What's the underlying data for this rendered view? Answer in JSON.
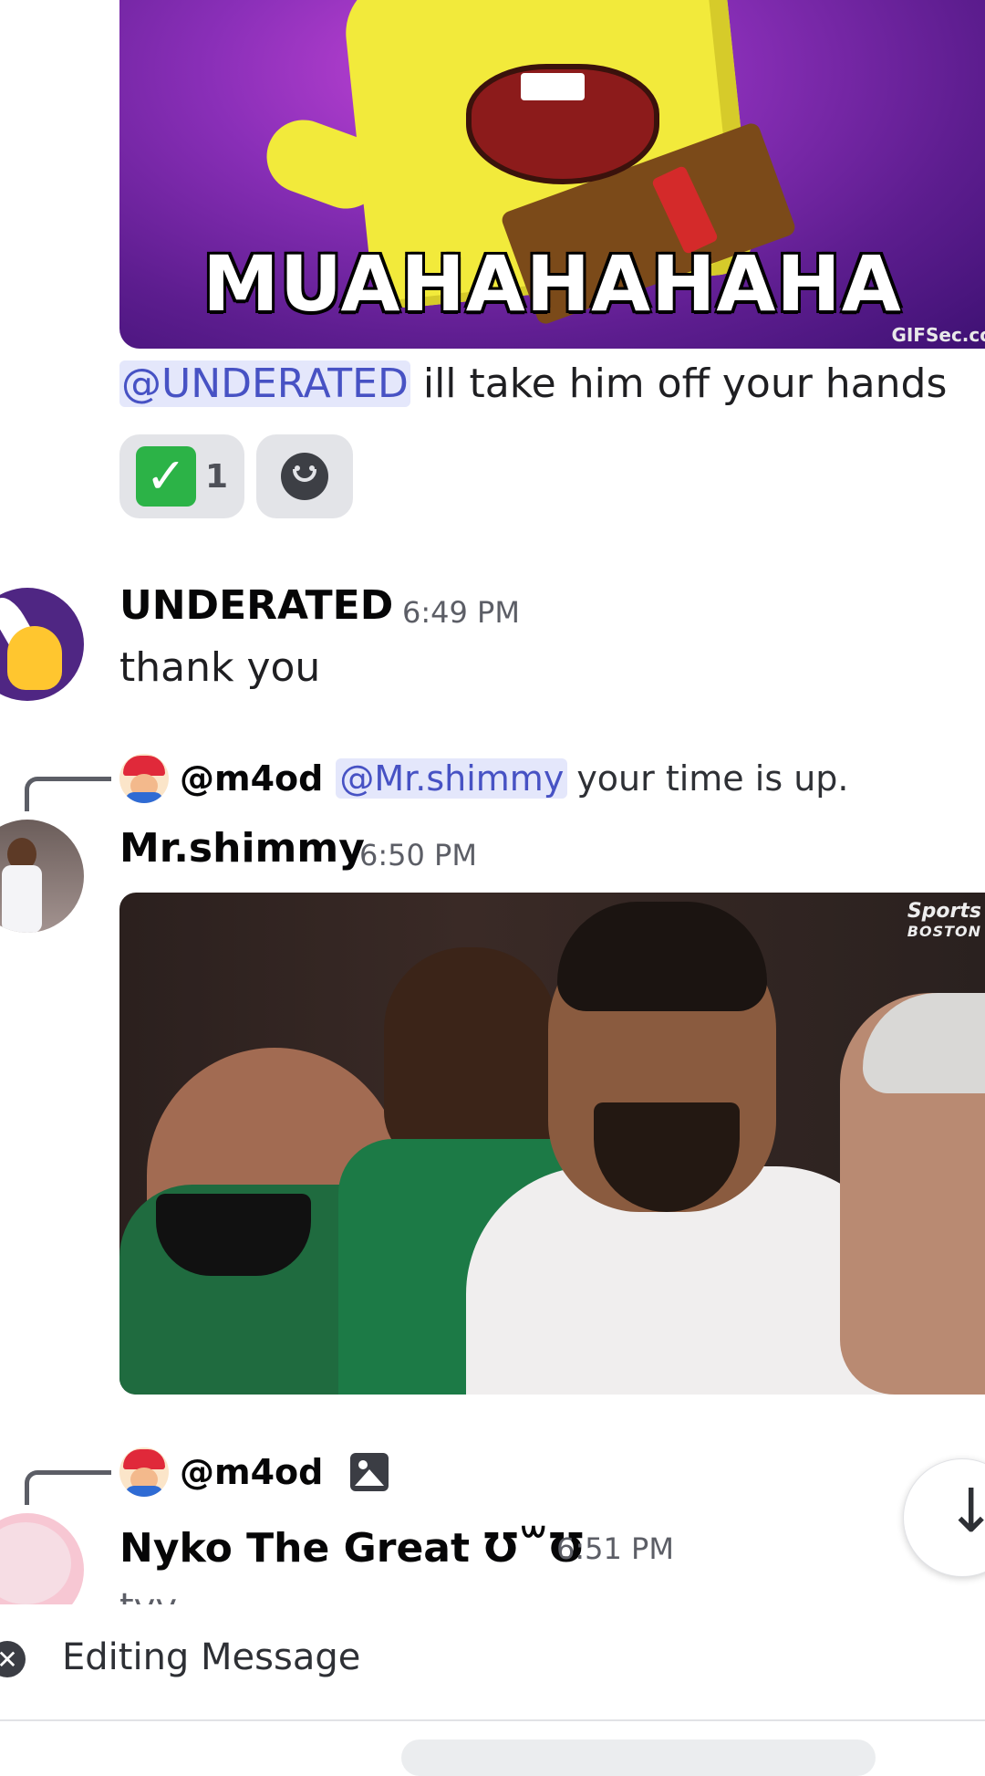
{
  "gif": {
    "caption": "MUAHAHAHAHA",
    "watermark": "GIFSec.co"
  },
  "message1": {
    "mention": "@UNDERATED",
    "text": "ill take him off your hands",
    "reactions": [
      {
        "emoji": "✓",
        "icon": "check-mark-emoji",
        "count": "1"
      },
      {
        "icon": "add-reaction-icon"
      }
    ]
  },
  "message2": {
    "author": "UNDERATED",
    "time": "6:49 PM",
    "text": "thank you"
  },
  "message3": {
    "reply": {
      "user": "@m4od",
      "mention": "@Mr.shimmy",
      "text": "your time is up."
    },
    "author": "Mr.shimmy",
    "time": "6:50 PM",
    "image_logo_line1": "Sports",
    "image_logo_line2": "BOSTON"
  },
  "message4": {
    "reply": {
      "user": "@m4od"
    },
    "author": "Nyko The Great Ʊ꒳Ʊ",
    "time": "6:51 PM",
    "text": "tyy"
  },
  "bottom": {
    "editing_label": "Editing Message",
    "close_glyph": "✕"
  },
  "jump": {
    "arrow": "↓"
  }
}
